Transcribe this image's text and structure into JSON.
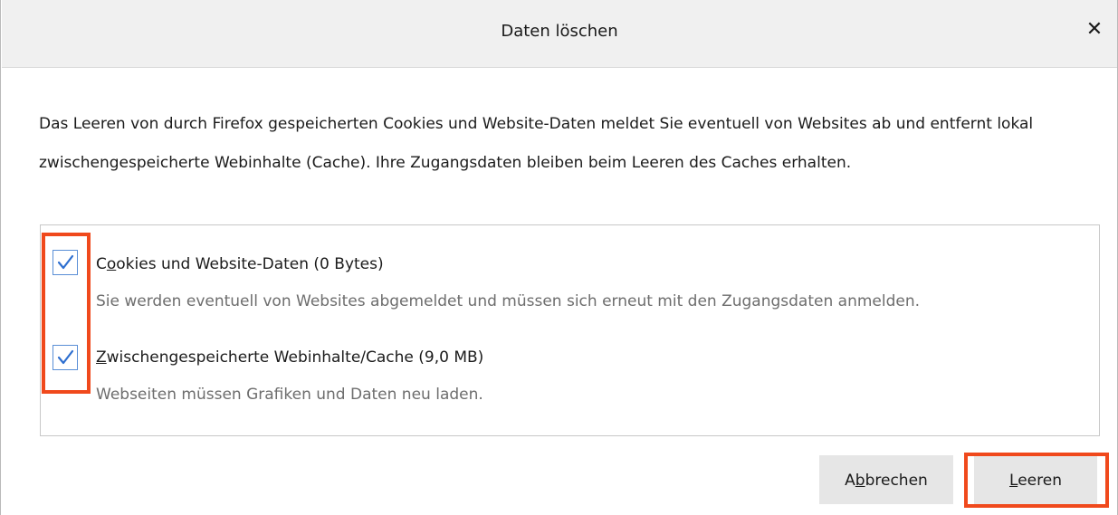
{
  "dialog": {
    "title": "Daten löschen",
    "close_symbol": "✕",
    "description": "Das Leeren von durch Firefox gespeicherten Cookies und Website-Daten meldet Sie eventuell von Websites ab und entfernt lokal zwischengespeicherte Webinhalte (Cache). Ihre Zugangsdaten bleiben beim Leeren des Caches erhalten."
  },
  "options": [
    {
      "label_prefix": "C",
      "label_accesskey": "o",
      "label_rest": "okies und Website-Daten (0 Bytes)",
      "description": "Sie werden eventuell von Websites abgemeldet und müssen sich erneut mit den Zugangsdaten anmelden.",
      "checked": true
    },
    {
      "label_prefix": "",
      "label_accesskey": "Z",
      "label_rest": "wischengespeicherte Webinhalte/Cache (9,0 MB)",
      "description": "Webseiten müssen Grafiken und Daten neu laden.",
      "checked": true
    }
  ],
  "buttons": {
    "cancel_prefix": "A",
    "cancel_accesskey": "b",
    "cancel_rest": "brechen",
    "confirm_prefix": "",
    "confirm_accesskey": "L",
    "confirm_rest": "eeren"
  },
  "colors": {
    "highlight": "#f0491c",
    "checkbox_border": "#5a8fd6",
    "checkmark": "#2e6fd0"
  },
  "icons": {
    "close": "close-icon",
    "checkmark": "checkmark-icon"
  }
}
